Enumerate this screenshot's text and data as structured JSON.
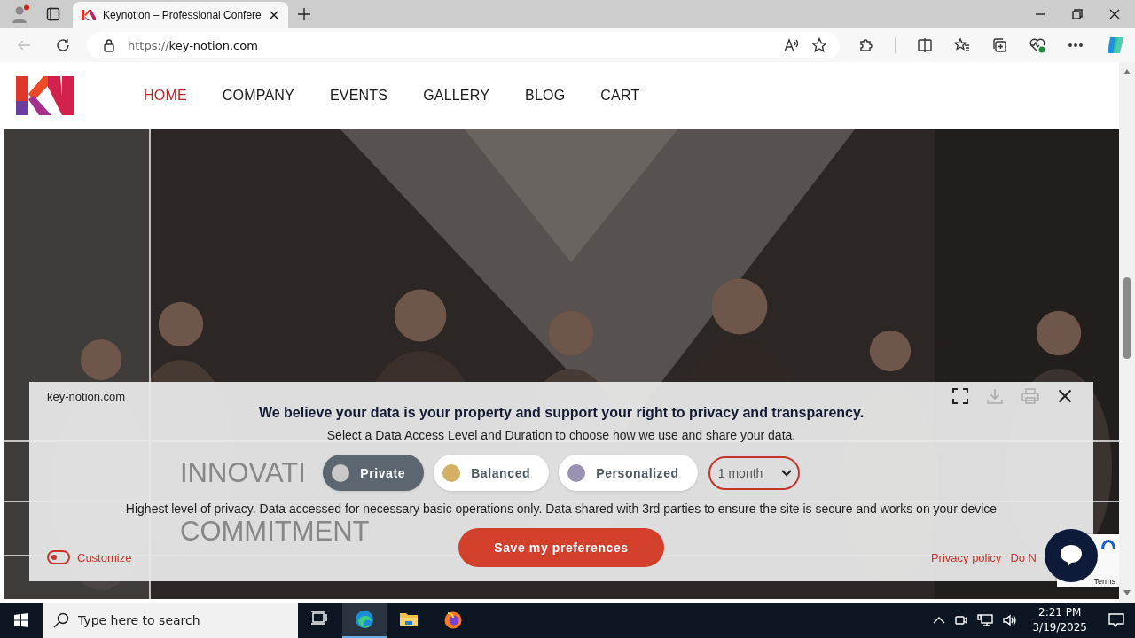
{
  "browser": {
    "tabs": [
      {
        "title": "Keynotion – Professional Confere",
        "selected": true
      }
    ],
    "url_scheme": "https://",
    "url_host": "key-notion.com"
  },
  "site": {
    "nav": [
      {
        "label": "HOME",
        "selected": true
      },
      {
        "label": "COMPANY",
        "selected": false
      },
      {
        "label": "EVENTS",
        "selected": false
      },
      {
        "label": "GALLERY",
        "selected": false
      },
      {
        "label": "BLOG",
        "selected": false
      },
      {
        "label": "CART",
        "selected": false
      }
    ]
  },
  "hero": {
    "lines": [
      "INNOVATI",
      "COMMITMENT"
    ]
  },
  "consent": {
    "site": "key-notion.com",
    "heading": "We believe your data is your property and support your right to privacy and transparency.",
    "subheading": "Select a Data Access Level and Duration to choose how we use and share your data.",
    "levels": [
      {
        "label": "Private",
        "color": "#c8c8c8",
        "selected": true
      },
      {
        "label": "Balanced",
        "color": "#d4b064",
        "selected": false
      },
      {
        "label": "Personalized",
        "color": "#9b91b3",
        "selected": false
      }
    ],
    "duration": "1 month",
    "description": "Highest level of privacy. Data accessed for necessary basic operations only. Data shared with 3rd parties to ensure the site is secure and works on your device",
    "save_button": "Save my preferences",
    "customize": {
      "label": "Customize",
      "on": false
    },
    "links": [
      "Privacy policy",
      "Do N"
    ]
  },
  "recaptcha": {
    "link": "Terms"
  },
  "taskbar": {
    "search_placeholder": "Type here to search",
    "apps": [
      {
        "kind": "task-view",
        "selected": false
      },
      {
        "kind": "edge",
        "selected": true
      },
      {
        "kind": "explorer",
        "selected": false
      },
      {
        "kind": "firefox",
        "selected": false
      }
    ],
    "time": "2:21 PM",
    "date": "3/19/2025"
  }
}
